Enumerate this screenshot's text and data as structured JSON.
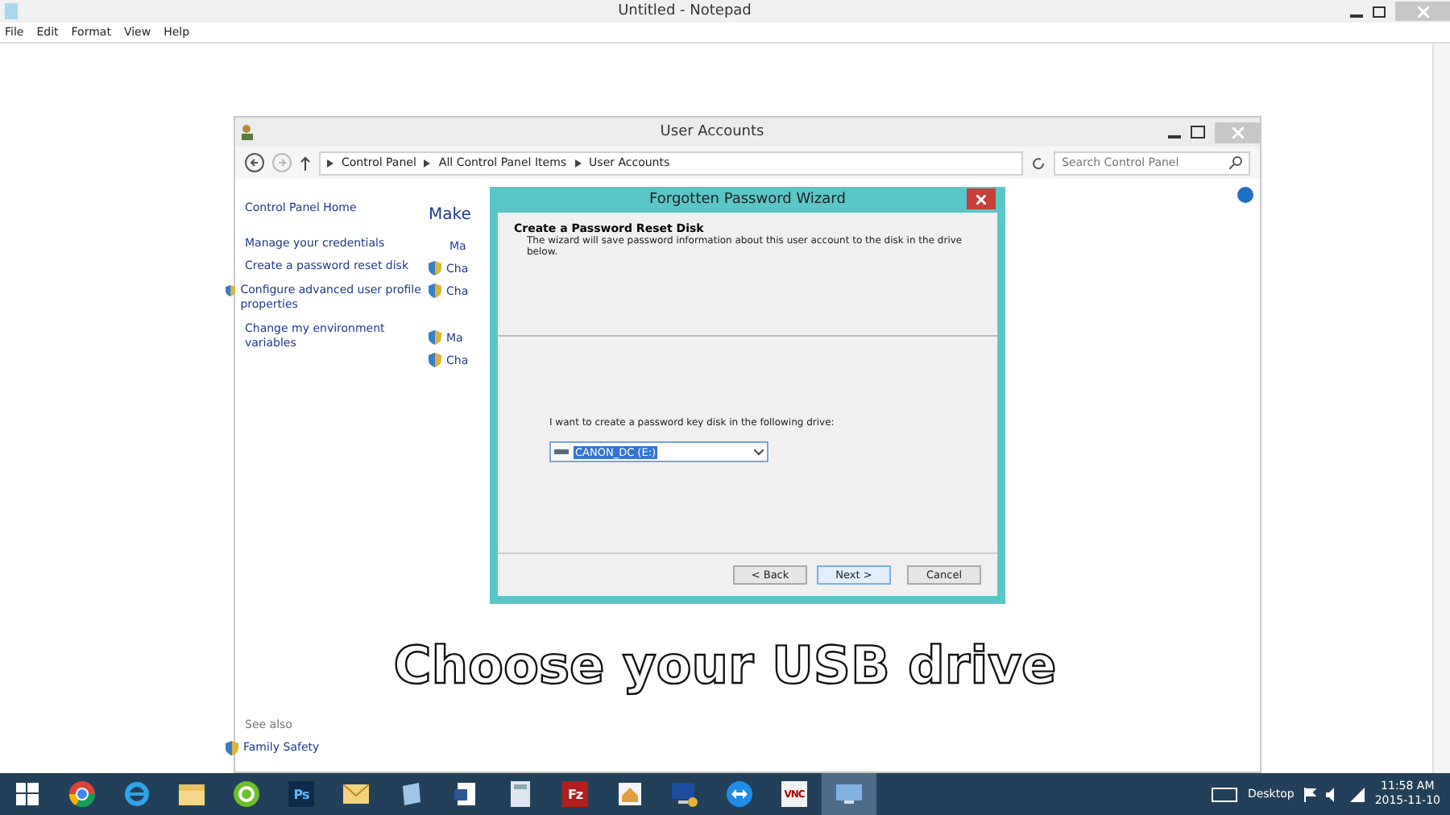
{
  "notepad": {
    "title": "Untitled - Notepad",
    "menu": [
      "File",
      "Edit",
      "Format",
      "View",
      "Help"
    ]
  },
  "user_accounts": {
    "title": "User Accounts",
    "breadcrumb": [
      "Control Panel",
      "All Control Panel Items",
      "User Accounts"
    ],
    "search": {
      "placeholder": "Search Control Panel"
    },
    "sidebar": [
      {
        "label": "Control Panel Home",
        "kind": "link"
      },
      {
        "label": "Manage your credentials",
        "kind": "link"
      },
      {
        "label": "Create a password reset disk",
        "kind": "link"
      },
      {
        "label": "Configure advanced user profile properties",
        "kind": "shield"
      },
      {
        "label": "Change my environment variables",
        "kind": "link"
      }
    ],
    "see_also": {
      "heading": "See also",
      "items": [
        {
          "label": "Family Safety",
          "kind": "shield"
        }
      ]
    },
    "main": {
      "heading": "Make",
      "links": [
        {
          "label": "Ma",
          "kind": "link"
        },
        {
          "label": "Cha",
          "kind": "shield"
        },
        {
          "label": "Cha",
          "kind": "shield"
        },
        {
          "label": "Ma",
          "kind": "shield"
        },
        {
          "label": "Cha",
          "kind": "shield"
        }
      ]
    }
  },
  "wizard": {
    "title": "Forgotten Password Wizard",
    "heading": "Create a Password Reset Disk",
    "description": "The wizard will save password information about this user account to the disk in the drive below.",
    "prompt": "I want to create a password key disk in the following drive:",
    "drive": {
      "value": "CANON_DC (E:)",
      "selected": true
    },
    "buttons": [
      {
        "label": "< Back",
        "default": false
      },
      {
        "label": "Next >",
        "default": true
      },
      {
        "label": "Cancel",
        "default": false
      }
    ]
  },
  "caption": "Choose your USB drive",
  "taskbar": {
    "apps": [
      {
        "kind": "browser-round"
      },
      {
        "kind": "browser-e"
      },
      {
        "kind": "folder"
      },
      {
        "kind": "green-d"
      },
      {
        "kind": "ps",
        "label": "Ps"
      },
      {
        "kind": "mail"
      },
      {
        "kind": "notebook"
      },
      {
        "kind": "doc"
      },
      {
        "kind": "calc"
      },
      {
        "kind": "fz",
        "label": "Fz"
      },
      {
        "kind": "house"
      },
      {
        "kind": "monitor"
      },
      {
        "kind": "arrows"
      },
      {
        "kind": "vnc",
        "label": "VNC"
      },
      {
        "kind": "remote",
        "selected": true
      }
    ],
    "desktop_label": "Desktop",
    "time": "11:58 AM",
    "date": "2015-11-10"
  }
}
